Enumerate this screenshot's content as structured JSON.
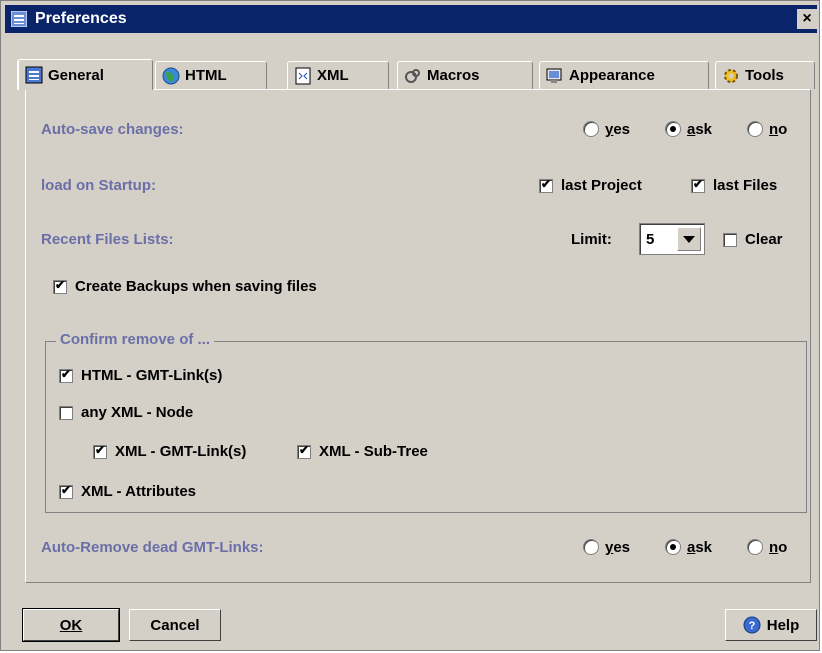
{
  "window": {
    "title": "Preferences",
    "close": "×"
  },
  "tabs": [
    {
      "label": "General",
      "icon": "general-icon"
    },
    {
      "label": "HTML",
      "icon": "globe-icon"
    },
    {
      "label": "XML",
      "icon": "xml-icon"
    },
    {
      "label": "Macros",
      "icon": "macros-icon"
    },
    {
      "label": "Appearance",
      "icon": "appearance-icon"
    },
    {
      "label": "Tools",
      "icon": "gear-icon"
    }
  ],
  "general": {
    "autosave": {
      "label": "Auto-save changes:",
      "options": [
        "yes",
        "ask",
        "no"
      ],
      "selected": "ask"
    },
    "load_on_startup": {
      "label": "load on Startup:",
      "last_project": "last Project",
      "last_files": "last Files",
      "last_project_checked": true,
      "last_files_checked": true
    },
    "recent_files": {
      "label": "Recent Files Lists:",
      "limit_label": "Limit:",
      "limit_value": "5",
      "clear_label": "Clear",
      "clear_checked": false
    },
    "create_backups": {
      "label": "Create Backups when saving files",
      "checked": true
    },
    "confirm_remove": {
      "legend": "Confirm remove of ...",
      "html_gmt_links": {
        "label": "HTML - GMT-Link(s)",
        "checked": true
      },
      "any_xml_node": {
        "label": "any XML - Node",
        "checked": false
      },
      "xml_gmt_links": {
        "label": "XML - GMT-Link(s)",
        "checked": true
      },
      "xml_sub_tree": {
        "label": "XML - Sub-Tree",
        "checked": true
      },
      "xml_attributes": {
        "label": "XML - Attributes",
        "checked": true
      }
    },
    "auto_remove": {
      "label": "Auto-Remove dead GMT-Links:",
      "options": [
        "yes",
        "ask",
        "no"
      ],
      "selected": "ask"
    }
  },
  "buttons": {
    "ok": "OK",
    "cancel": "Cancel",
    "help": "Help"
  },
  "colors": {
    "title_bar": "#0a246a",
    "dialog_bg": "#d4d0c8",
    "section_label": "#6b6fa8"
  }
}
